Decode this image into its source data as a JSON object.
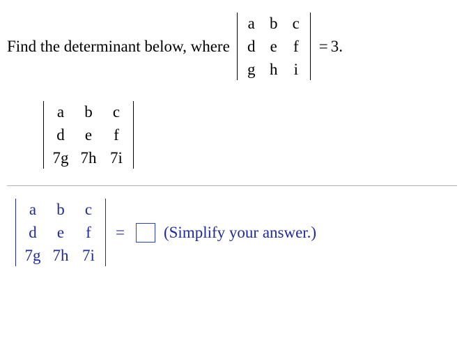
{
  "problem": {
    "prefix_text": "Find the determinant below, where",
    "given_matrix": {
      "rows": [
        [
          "a",
          "b",
          "c"
        ],
        [
          "d",
          "e",
          "f"
        ],
        [
          "g",
          "h",
          "i"
        ]
      ]
    },
    "equals": "=",
    "given_value": "3",
    "suffix": "."
  },
  "target_matrix": {
    "rows": [
      [
        "a",
        "b",
        "c"
      ],
      [
        "d",
        "e",
        "f"
      ],
      [
        "7g",
        "7h",
        "7i"
      ]
    ]
  },
  "answer_line": {
    "matrix": {
      "rows": [
        [
          "a",
          "b",
          "c"
        ],
        [
          "d",
          "e",
          "f"
        ],
        [
          "7g",
          "7h",
          "7i"
        ]
      ]
    },
    "equals": "=",
    "hint": "(Simplify your answer.)"
  }
}
